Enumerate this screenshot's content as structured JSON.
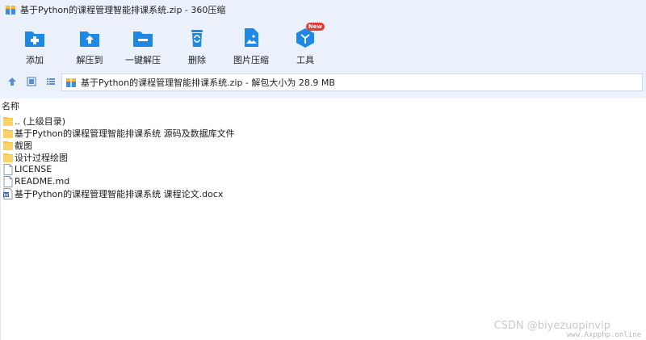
{
  "window": {
    "title": "基于Python的课程管理智能排课系统.zip - 360压缩"
  },
  "toolbar": {
    "items": [
      {
        "label": "添加",
        "icon": "add-icon"
      },
      {
        "label": "解压到",
        "icon": "extract-to-icon"
      },
      {
        "label": "一键解压",
        "icon": "one-click-extract-icon"
      },
      {
        "label": "删除",
        "icon": "delete-icon"
      },
      {
        "label": "图片压缩",
        "icon": "image-compress-icon"
      },
      {
        "label": "工具",
        "icon": "tools-icon",
        "badge": "New"
      }
    ]
  },
  "address": {
    "path": "基于Python的课程管理智能排课系统.zip - 解包大小为 28.9 MB"
  },
  "list": {
    "column_header": "名称",
    "items": [
      {
        "name": ".. (上级目录)",
        "type": "folder"
      },
      {
        "name": "基于Python的课程管理智能排课系统 源码及数据库文件",
        "type": "folder"
      },
      {
        "name": "截图",
        "type": "folder"
      },
      {
        "name": "设计过程绘图",
        "type": "folder"
      },
      {
        "name": "LICENSE",
        "type": "file"
      },
      {
        "name": "README.md",
        "type": "file"
      },
      {
        "name": "基于Python的课程管理智能排课系统 课程论文.docx",
        "type": "docx"
      }
    ]
  },
  "watermark": {
    "text": "CSDN @biyezuopinvip",
    "site": "www.Axpphp.online"
  },
  "colors": {
    "accent": "#1e88e5",
    "toolbar_bg": "#eaf1fb",
    "folder": "#f5c242",
    "badge": "#e53935"
  }
}
